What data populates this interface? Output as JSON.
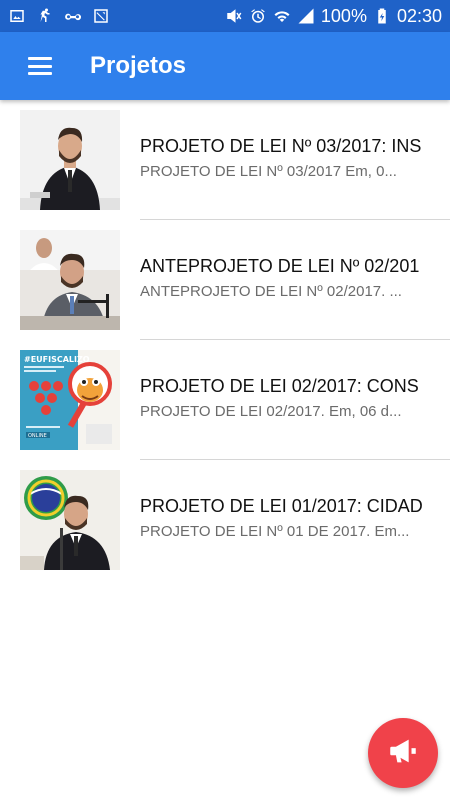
{
  "status_bar": {
    "battery_percent": "100%",
    "time": "02:30"
  },
  "app_bar": {
    "title": "Projetos"
  },
  "items": [
    {
      "title": "PROJETO DE LEI Nº 03/2017: INS",
      "subtitle": "PROJETO DE LEI Nº 03/2017 Em, 0..."
    },
    {
      "title": "ANTEPROJETO DE LEI Nº 02/201",
      "subtitle": "ANTEPROJETO DE LEI Nº 02/2017. ..."
    },
    {
      "title": "PROJETO DE LEI 02/2017: CONS",
      "subtitle": " PROJETO DE LEI 02/2017. Em, 06 d..."
    },
    {
      "title": "PROJETO DE LEI 01/2017: CIDAD",
      "subtitle": "PROJETO DE LEI Nº 01 DE 2017. Em..."
    }
  ],
  "thumb3_text": {
    "hashtag": "#EUFISCALIZO",
    "badge": "ONLINE"
  },
  "colors": {
    "status_bar": "#1f62c8",
    "app_bar": "#2f80ec",
    "fab": "#f0424a"
  },
  "icons": [
    "menu-icon",
    "megaphone-icon"
  ]
}
